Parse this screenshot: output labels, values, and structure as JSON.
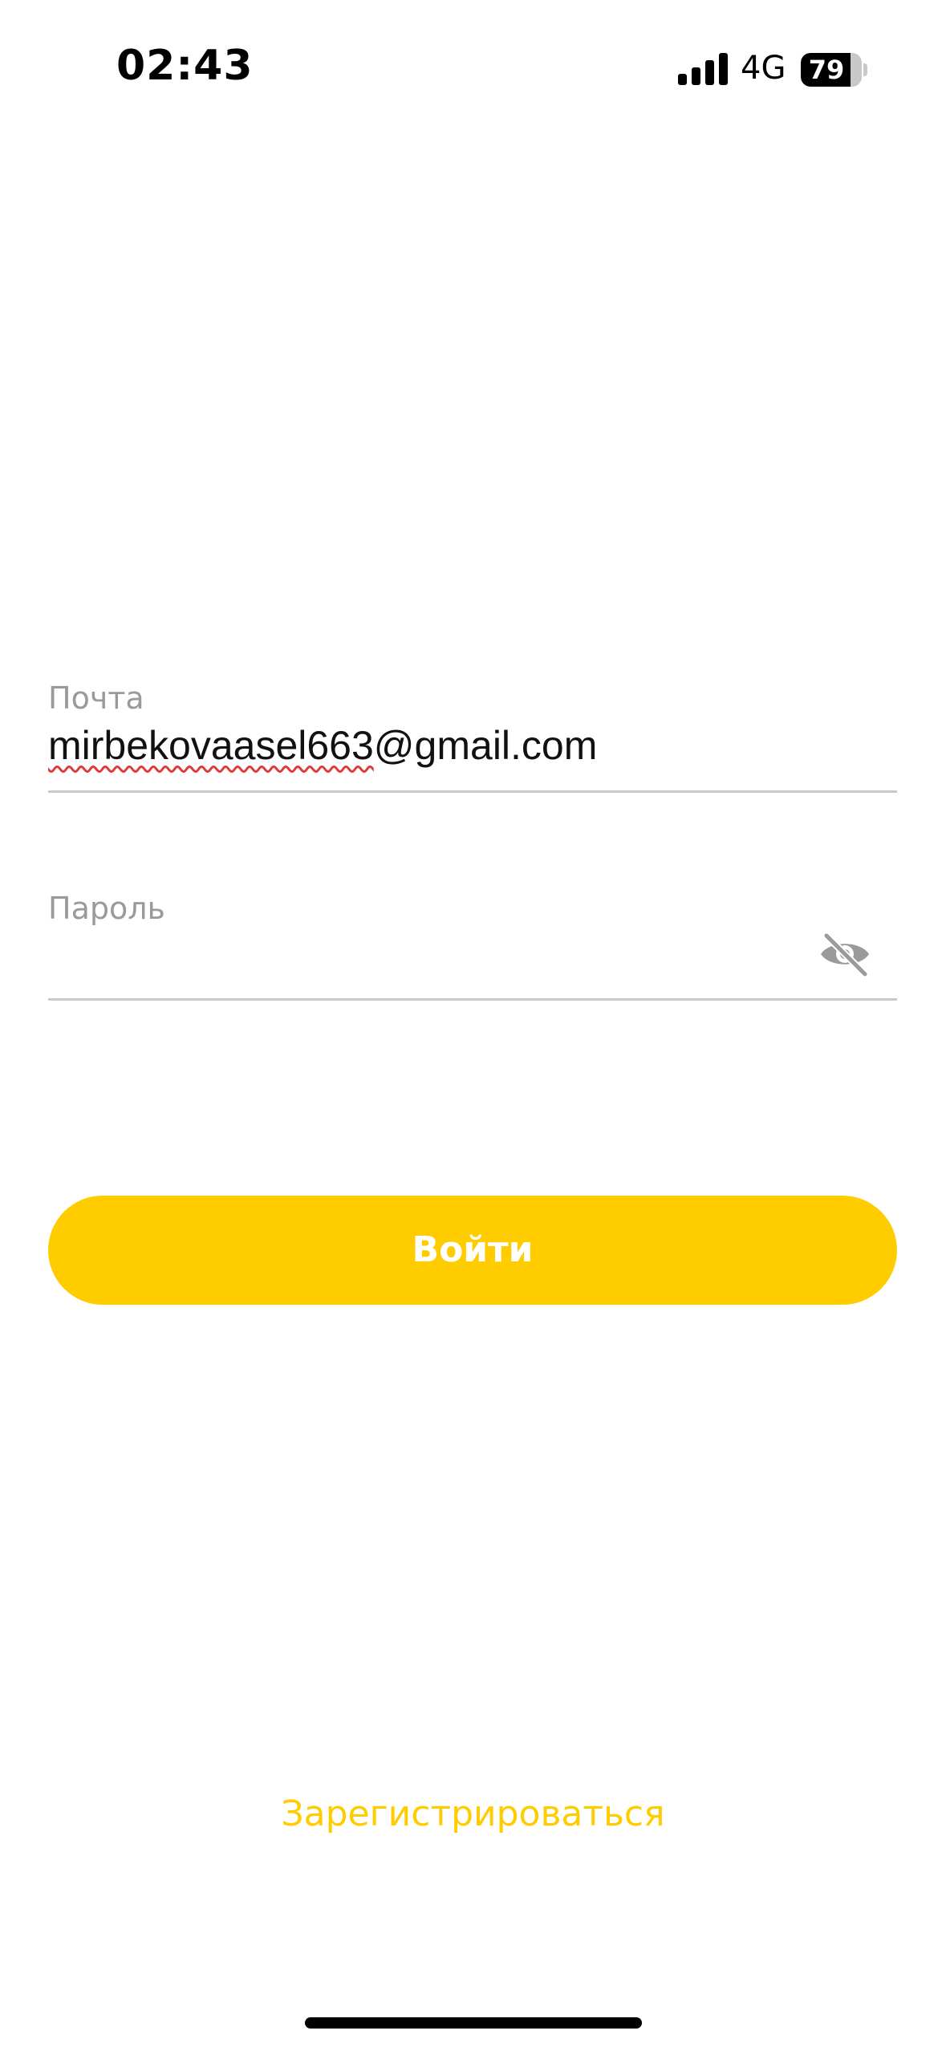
{
  "status_bar": {
    "time": "02:43",
    "network": "4G",
    "battery_percent": "79",
    "signal_icon": "cellular-signal-icon",
    "battery_icon": "battery-icon"
  },
  "login_form": {
    "email": {
      "label": "Почта",
      "value_misspelled": "mirbekovaasel663",
      "value_rest": "@gmail.com"
    },
    "password": {
      "label": "Пароль",
      "value": "",
      "toggle_icon": "eye-off-icon"
    },
    "submit_label": "Войти",
    "register_label": "Зарегистрироваться"
  },
  "colors": {
    "accent": "#ffcc00",
    "label": "#9a9a9a",
    "divider": "#c9c9c9",
    "spellcheck": "#e03b3b"
  }
}
